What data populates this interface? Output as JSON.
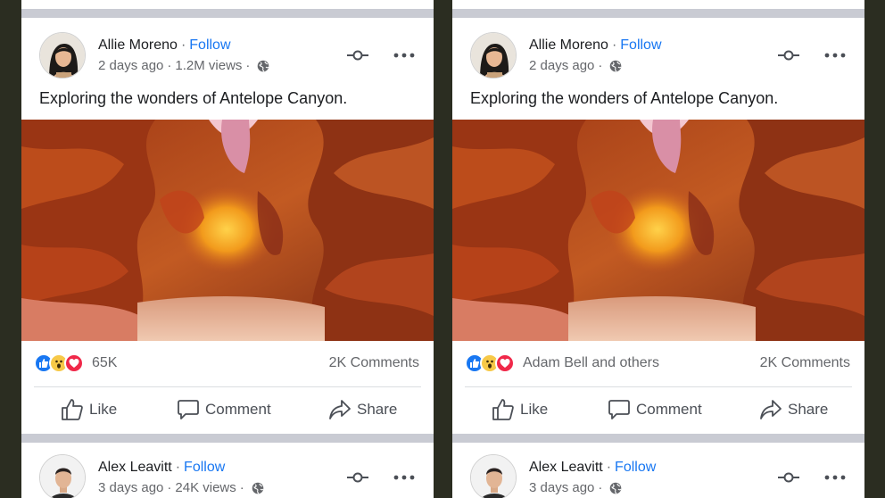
{
  "colors": {
    "link_blue": "#1877f2",
    "secondary_text": "#65676b",
    "separator": "#c9cbd3",
    "bezel": "#2b2d21"
  },
  "panels": [
    {
      "post": {
        "author": "Allie Moreno",
        "separator": "·",
        "follow_label": "Follow",
        "time": "2 days ago",
        "views": "1.2M views",
        "audience_icon": "globe-icon",
        "caption": "Exploring the wonders of Antelope Canyon.",
        "reactions": [
          "like-icon",
          "wow-icon",
          "love-icon"
        ],
        "reaction_summary": "65K",
        "comments": "2K Comments",
        "actions": {
          "like": "Like",
          "comment": "Comment",
          "share": "Share"
        }
      },
      "next_post": {
        "author": "Alex Leavitt",
        "separator": "·",
        "follow_label": "Follow",
        "time": "3 days ago",
        "views": "24K views",
        "audience_icon": "globe-icon"
      }
    },
    {
      "post": {
        "author": "Allie Moreno",
        "separator": "·",
        "follow_label": "Follow",
        "time": "2 days ago",
        "audience_icon": "globe-icon",
        "caption": "Exploring the wonders of Antelope Canyon.",
        "reactions": [
          "like-icon",
          "wow-icon",
          "love-icon"
        ],
        "reaction_summary": "Adam Bell and others",
        "comments": "2K Comments",
        "actions": {
          "like": "Like",
          "comment": "Comment",
          "share": "Share"
        }
      },
      "next_post": {
        "author": "Alex Leavitt",
        "separator": "·",
        "follow_label": "Follow",
        "time": "3 days ago",
        "audience_icon": "globe-icon"
      }
    }
  ]
}
